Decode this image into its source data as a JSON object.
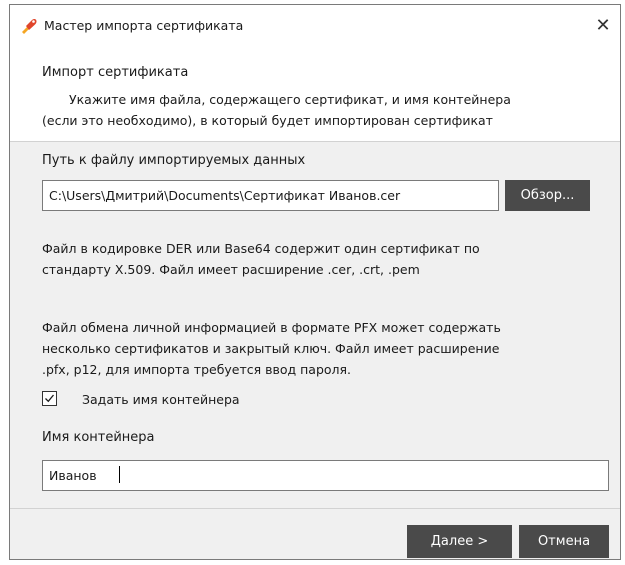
{
  "window": {
    "title": "Мастер импорта сертификата",
    "close_glyph": "✕",
    "icon": "certificate-wizard-icon"
  },
  "header": {
    "title": "Импорт сертификата",
    "description_line1": "Укажите имя файла, содержащего сертификат, и имя контейнера",
    "description_line2": "(если это необходимо), в который будет импортирован сертификат"
  },
  "file": {
    "label": "Путь к файлу импортируемых данных",
    "path_value": "C:\\Users\\Дмитрий\\Documents\\Сертификат Иванов.cer",
    "browse_label": "Обзор..."
  },
  "info": {
    "der_line1": "Файл в кодировке DER или Base64 содержит один сертификат по",
    "der_line2": "стандарту X.509. Файл имеет расширение .cer, .crt, .pem",
    "pfx_line1": "Файл обмена личной информацией в формате PFX может содержать",
    "pfx_line2": "несколько сертификатов и закрытый ключ. Файл имеет расширение",
    "pfx_line3": ".pfx, p12, для импорта требуется ввод пароля."
  },
  "container": {
    "checkbox_label": "Задать имя контейнера",
    "checkbox_checked": true,
    "name_label": "Имя контейнера",
    "name_value": "Иванов"
  },
  "footer": {
    "next_label": "Далее >",
    "cancel_label": "Отмена"
  },
  "colors": {
    "button_bg": "#4a4a4a",
    "icon_red": "#e0452b",
    "icon_orange": "#f5a623"
  }
}
